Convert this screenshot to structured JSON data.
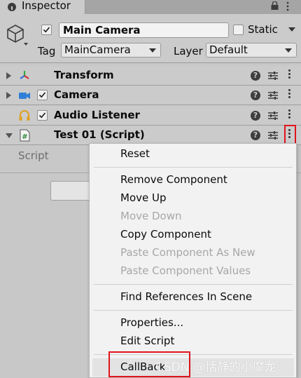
{
  "tab": {
    "title": "Inspector"
  },
  "gameobject": {
    "name": "Main Camera",
    "static_label": "Static",
    "tag_label": "Tag",
    "tag_value": "MainCamera",
    "layer_label": "Layer",
    "layer_value": "Default"
  },
  "components": [
    {
      "name": "Transform",
      "icon": "transform-icon"
    },
    {
      "name": "Camera",
      "icon": "camera-icon"
    },
    {
      "name": "Audio Listener",
      "icon": "headphones-icon"
    },
    {
      "name": "Test 01 (Script)",
      "icon": "csharp-script-icon"
    }
  ],
  "script_field_label": "Script",
  "context_menu": {
    "items": [
      {
        "label": "Reset",
        "enabled": true
      },
      {
        "label": "Remove Component",
        "enabled": true
      },
      {
        "label": "Move Up",
        "enabled": true
      },
      {
        "label": "Move Down",
        "enabled": false
      },
      {
        "label": "Copy Component",
        "enabled": true
      },
      {
        "label": "Paste Component As New",
        "enabled": false
      },
      {
        "label": "Paste Component Values",
        "enabled": false
      },
      {
        "label": "Find References In Scene",
        "enabled": true
      },
      {
        "label": "Properties...",
        "enabled": true
      },
      {
        "label": "Edit Script",
        "enabled": true
      },
      {
        "label": "CallBack",
        "enabled": true,
        "highlighted": true
      }
    ]
  },
  "watermark": "CSDN @恬静的小魔龙",
  "colors": {
    "annotation_red": "#e0141b",
    "panel": "#cbcbcb",
    "menu": "#f2f2f2"
  }
}
